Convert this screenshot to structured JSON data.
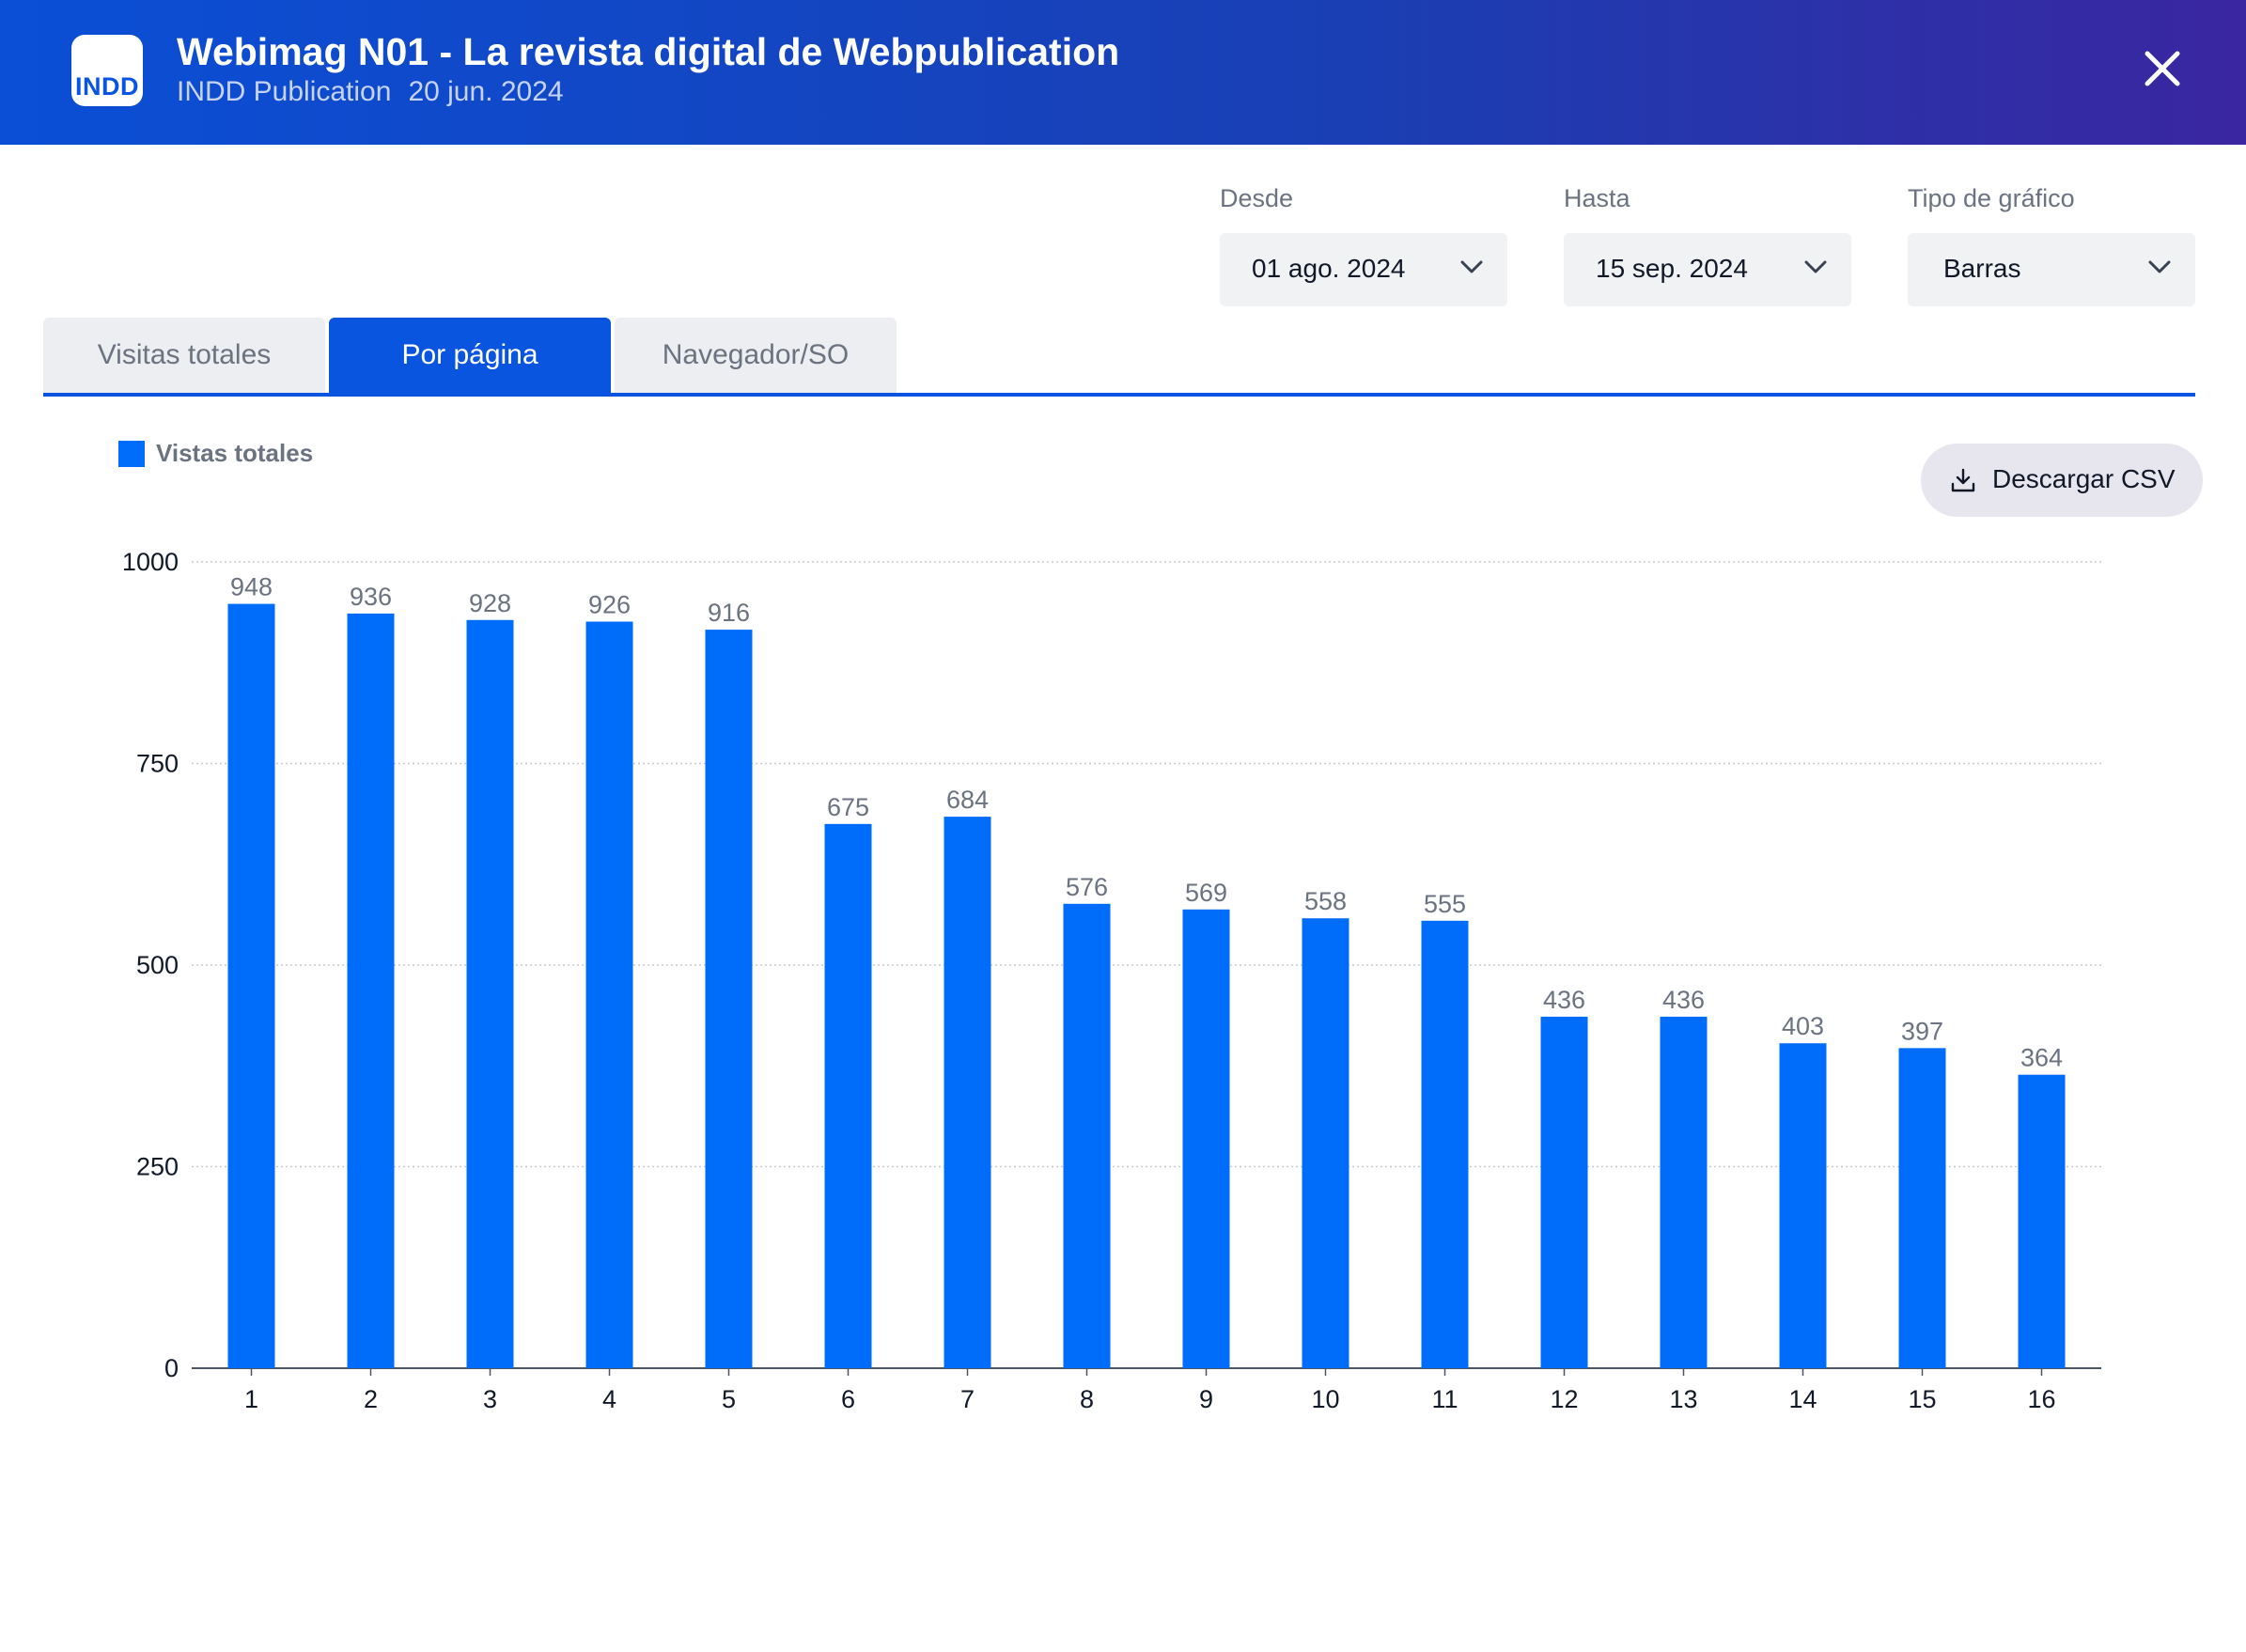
{
  "header": {
    "app_icon_text": "INDD",
    "title": "Webimag N01 - La revista digital de Webpublication",
    "publication_type": "INDD Publication",
    "publication_date": "20 jun. 2024",
    "close_icon": "close-icon"
  },
  "filters": {
    "from": {
      "label": "Desde",
      "value": "01 ago. 2024"
    },
    "to": {
      "label": "Hasta",
      "value": "15 sep. 2024"
    },
    "chart_type": {
      "label": "Tipo de gráfico",
      "value": "Barras"
    }
  },
  "tabs": [
    {
      "label": "Visitas totales",
      "active": false
    },
    {
      "label": "Por página",
      "active": true
    },
    {
      "label": "Navegador/SO",
      "active": false
    }
  ],
  "download": {
    "label": "Descargar CSV",
    "icon": "download-icon"
  },
  "colors": {
    "header_start": "#0a4fd6",
    "header_end": "#3a26a0",
    "accent": "#0a55e0",
    "bar": "#006cfa"
  },
  "chart_data": {
    "type": "bar",
    "categories": [
      "1",
      "2",
      "3",
      "4",
      "5",
      "6",
      "7",
      "8",
      "9",
      "10",
      "11",
      "12",
      "13",
      "14",
      "15",
      "16"
    ],
    "series": [
      {
        "name": "Vistas totales",
        "values": [
          948,
          936,
          928,
          926,
          916,
          675,
          684,
          576,
          569,
          558,
          555,
          436,
          436,
          403,
          397,
          364
        ]
      }
    ],
    "y_ticks": [
      "0",
      "250",
      "500",
      "750",
      "1000"
    ],
    "ylim": [
      0,
      1000
    ],
    "grid": true,
    "legend_position": "top-left",
    "data_labels": true
  }
}
